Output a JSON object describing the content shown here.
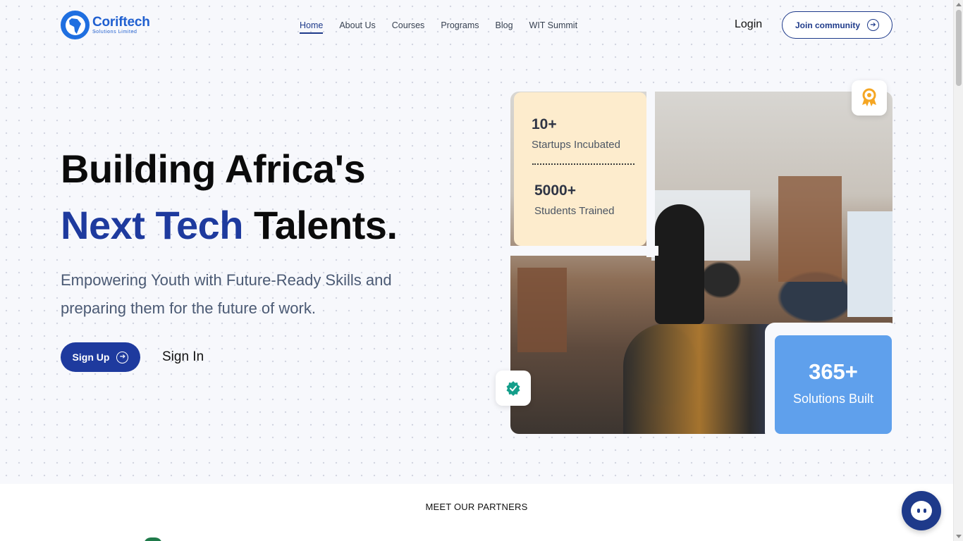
{
  "brand": {
    "name": "Coriftech",
    "tagline": "Solutions Limited",
    "color": "#1f5fd0"
  },
  "nav": {
    "items": [
      {
        "label": "Home",
        "active": true
      },
      {
        "label": "About Us"
      },
      {
        "label": "Courses"
      },
      {
        "label": "Programs"
      },
      {
        "label": "Blog"
      },
      {
        "label": "WIT Summit"
      }
    ],
    "login": "Login",
    "join": "Join community"
  },
  "hero": {
    "title_line1": "Building Africa's",
    "title_accent": "Next Tech",
    "title_rest": " Talents.",
    "subtitle": "Empowering Youth with Future-Ready Skills and preparing them for the future of work.",
    "signup": "Sign Up",
    "signin": "Sign In",
    "accent_color": "#1e3a9e"
  },
  "stats": {
    "startups_value": "10+",
    "startups_label": "Startups Incubated",
    "students_value": "5000+",
    "students_label": "Students Trained",
    "solutions_value": "365+",
    "solutions_label": "Solutions Built"
  },
  "icons": {
    "award": "award-ribbon-icon",
    "verified": "verified-badge-icon",
    "arrow": "arrow-right-circle-icon",
    "chat": "chat-bubble-icon"
  },
  "partners": {
    "title": "MEET OUR PARTNERS"
  }
}
